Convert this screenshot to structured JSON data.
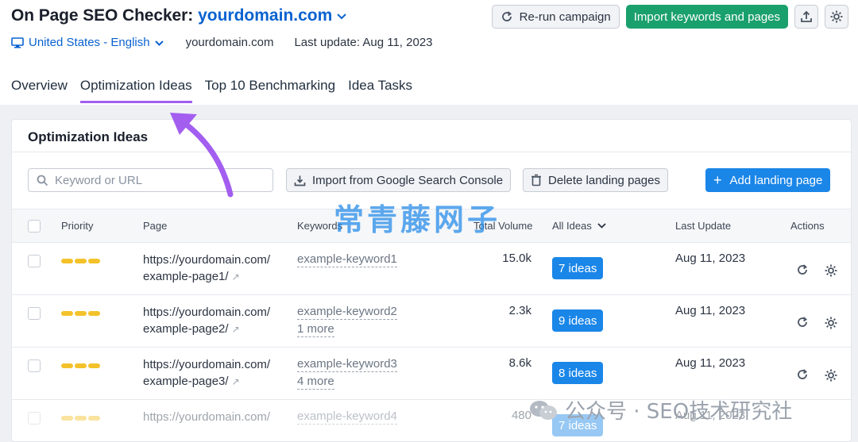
{
  "header": {
    "title": "On Page SEO Checker:",
    "domain": "yourdomain.com",
    "locale": "United States - English",
    "project_domain": "yourdomain.com",
    "last_update": "Last update: Aug 11, 2023",
    "rerun_label": "Re-run campaign",
    "import_label": "Import keywords and pages"
  },
  "tabs": [
    {
      "label": "Overview"
    },
    {
      "label": "Optimization Ideas"
    },
    {
      "label": "Top 10 Benchmarking"
    },
    {
      "label": "Idea Tasks"
    }
  ],
  "card": {
    "title": "Optimization Ideas",
    "search_placeholder": "Keyword or URL",
    "import_gsc_label": "Import from Google Search Console",
    "delete_label": "Delete landing pages",
    "add_label": "Add landing page"
  },
  "columns": {
    "priority": "Priority",
    "page": "Page",
    "keywords": "Keywords",
    "total_volume": "Total Volume",
    "all_ideas": "All Ideas",
    "last_update": "Last Update",
    "actions": "Actions"
  },
  "rows": [
    {
      "page_l1": "https://yourdomain.com/",
      "page_l2": "example-page1/",
      "keyword": "example-keyword1",
      "more": "",
      "volume": "15.0k",
      "ideas": "7 ideas",
      "date": "Aug 11, 2023"
    },
    {
      "page_l1": "https://yourdomain.com/",
      "page_l2": "example-page2/",
      "keyword": "example-keyword2",
      "more": "1 more",
      "volume": "2.3k",
      "ideas": "9 ideas",
      "date": "Aug 11, 2023"
    },
    {
      "page_l1": "https://yourdomain.com/",
      "page_l2": "example-page3/",
      "keyword": "example-keyword3",
      "more": "4 more",
      "volume": "8.6k",
      "ideas": "8 ideas",
      "date": "Aug 11, 2023"
    },
    {
      "page_l1": "https://yourdomain.com/",
      "page_l2": "",
      "keyword": "example-keyword4",
      "more": "",
      "volume": "480",
      "ideas": "7 ideas",
      "date": "Aug 11, 2023"
    }
  ],
  "overlay": {
    "watermark": "常青藤网子",
    "wechat": "公众号 · SEO技术研究社"
  },
  "colors": {
    "accent_blue": "#1a86e8",
    "green": "#1aa06d",
    "tab_underline": "#a35ef0",
    "priority_bar": "#f3c22a"
  }
}
